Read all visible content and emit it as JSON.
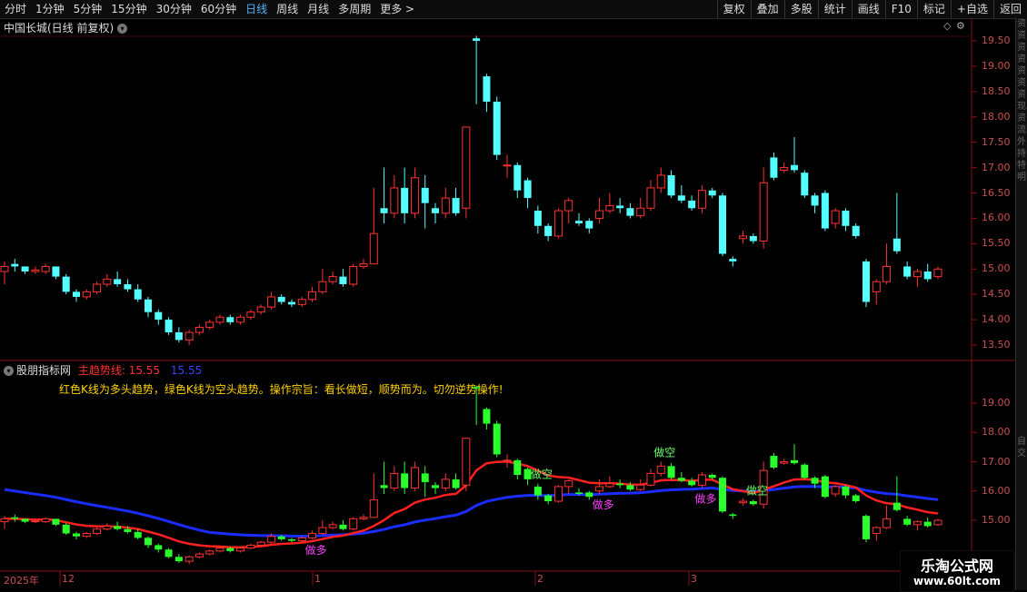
{
  "toolbar": {
    "periods": [
      "分时",
      "1分钟",
      "5分钟",
      "15分钟",
      "30分钟",
      "60分钟",
      "日线",
      "周线",
      "月线",
      "多周期",
      "更多 >"
    ],
    "active_period": "日线",
    "right_buttons": [
      "复权",
      "叠加",
      "多股",
      "统计",
      "画线",
      "F10",
      "标记",
      "+自选",
      "返回"
    ]
  },
  "stock_title": "中国长城(日线 前复权)",
  "indicator": {
    "name": "股朋指标网",
    "main_trend_label": "主趋势线: 15.55",
    "second_value": "15.55",
    "description": "红色K线为多头趋势，绿色K线为空头趋势。操作宗旨：看长做短，顺势而为。切勿逆势操作!"
  },
  "signals": {
    "short": "做空",
    "long": "做多"
  },
  "right_edge_text": [
    "资",
    "资",
    "资",
    "资",
    "资",
    "资",
    "资",
    "现",
    "资",
    "流",
    "外",
    "持",
    "特",
    "明"
  ],
  "right_edge_text2": [
    "自",
    "交"
  ],
  "timeline": {
    "year": "2025年",
    "months": [
      "12",
      "1",
      "2",
      "3"
    ]
  },
  "watermark": {
    "line1": "乐淘公式网",
    "line2": "www.60lt.com"
  },
  "colors": {
    "up": "#ff3232",
    "down_main": "#54ffff",
    "down_ind": "#2bff2b",
    "ma_red": "#ff2020",
    "ma_blue": "#1a2cff",
    "signal_green": "#6cff6c",
    "signal_magenta": "#ff40ff"
  },
  "chart_data": [
    {
      "type": "candlestick",
      "title": "中国长城(日线 前复权)",
      "y_ticks": [
        19.5,
        19.0,
        18.5,
        18.0,
        17.5,
        17.0,
        16.5,
        16.0,
        15.5,
        15.0,
        14.5,
        14.0,
        13.5
      ],
      "ylim": [
        13.2,
        19.8
      ],
      "candles": [
        [
          14.95,
          15.05,
          15.15,
          14.7
        ],
        [
          15.1,
          15.05,
          15.2,
          14.95
        ],
        [
          15.05,
          14.95,
          15.05,
          14.9
        ],
        [
          14.95,
          14.98,
          15.05,
          14.9
        ],
        [
          14.95,
          15.05,
          15.1,
          14.9
        ],
        [
          15.05,
          14.85,
          15.05,
          14.8
        ],
        [
          14.85,
          14.55,
          14.9,
          14.5
        ],
        [
          14.55,
          14.45,
          14.6,
          14.35
        ],
        [
          14.45,
          14.55,
          14.6,
          14.4
        ],
        [
          14.55,
          14.7,
          14.75,
          14.5
        ],
        [
          14.7,
          14.8,
          14.9,
          14.65
        ],
        [
          14.8,
          14.7,
          14.95,
          14.65
        ],
        [
          14.7,
          14.6,
          14.8,
          14.55
        ],
        [
          14.6,
          14.4,
          14.7,
          14.35
        ],
        [
          14.4,
          14.15,
          14.45,
          14.05
        ],
        [
          14.15,
          14.0,
          14.2,
          13.9
        ],
        [
          14.0,
          13.75,
          14.05,
          13.7
        ],
        [
          13.75,
          13.6,
          13.85,
          13.55
        ],
        [
          13.6,
          13.75,
          13.8,
          13.5
        ],
        [
          13.75,
          13.85,
          13.9,
          13.7
        ],
        [
          13.85,
          13.95,
          14.0,
          13.8
        ],
        [
          13.95,
          14.05,
          14.1,
          13.9
        ],
        [
          14.05,
          13.95,
          14.1,
          13.9
        ],
        [
          13.95,
          14.05,
          14.1,
          13.9
        ],
        [
          14.05,
          14.15,
          14.2,
          14.0
        ],
        [
          14.15,
          14.25,
          14.3,
          14.1
        ],
        [
          14.25,
          14.45,
          14.55,
          14.2
        ],
        [
          14.45,
          14.35,
          14.5,
          14.3
        ],
        [
          14.35,
          14.3,
          14.4,
          14.25
        ],
        [
          14.3,
          14.4,
          14.45,
          14.25
        ],
        [
          14.4,
          14.55,
          14.65,
          14.35
        ],
        [
          14.55,
          14.75,
          15.0,
          14.5
        ],
        [
          14.75,
          14.85,
          14.95,
          14.7
        ],
        [
          14.85,
          14.7,
          15.0,
          14.65
        ],
        [
          14.7,
          15.05,
          15.1,
          14.65
        ],
        [
          15.05,
          15.1,
          15.2,
          15.0
        ],
        [
          15.1,
          15.7,
          16.6,
          15.1
        ],
        [
          16.2,
          16.1,
          17.0,
          15.9
        ],
        [
          16.1,
          16.6,
          16.85,
          16.0
        ],
        [
          16.6,
          16.1,
          17.0,
          15.9
        ],
        [
          16.1,
          16.8,
          17.0,
          16.0
        ],
        [
          16.6,
          16.3,
          16.85,
          15.8
        ],
        [
          16.2,
          16.1,
          16.3,
          15.9
        ],
        [
          16.1,
          16.4,
          16.6,
          16.0
        ],
        [
          16.4,
          16.1,
          16.6,
          16.05
        ],
        [
          16.2,
          17.8,
          17.8,
          16.0
        ],
        [
          19.55,
          19.5,
          19.6,
          18.25
        ],
        [
          18.8,
          18.3,
          18.85,
          18.1
        ],
        [
          18.3,
          17.25,
          18.4,
          17.15
        ],
        [
          17.05,
          17.05,
          17.25,
          16.8
        ],
        [
          17.05,
          16.55,
          17.1,
          16.4
        ],
        [
          16.75,
          16.4,
          16.8,
          16.2
        ],
        [
          16.15,
          15.85,
          16.25,
          15.7
        ],
        [
          15.85,
          15.65,
          15.9,
          15.55
        ],
        [
          15.65,
          16.15,
          16.2,
          15.6
        ],
        [
          16.15,
          16.35,
          16.4,
          15.9
        ],
        [
          15.95,
          15.9,
          16.1,
          15.85
        ],
        [
          15.95,
          15.8,
          16.0,
          15.7
        ],
        [
          16.0,
          16.15,
          16.4,
          15.9
        ],
        [
          16.15,
          16.25,
          16.5,
          16.1
        ],
        [
          16.25,
          16.2,
          16.4,
          16.1
        ],
        [
          16.2,
          16.05,
          16.3,
          16.0
        ],
        [
          16.05,
          16.2,
          16.4,
          16.0
        ],
        [
          16.2,
          16.6,
          16.75,
          16.15
        ],
        [
          16.6,
          16.85,
          17.0,
          16.5
        ],
        [
          16.85,
          16.45,
          16.95,
          16.4
        ],
        [
          16.45,
          16.35,
          16.65,
          16.3
        ],
        [
          16.35,
          16.2,
          16.45,
          16.15
        ],
        [
          16.2,
          16.55,
          16.65,
          16.1
        ],
        [
          16.55,
          16.45,
          16.6,
          16.4
        ],
        [
          16.45,
          15.3,
          16.5,
          15.25
        ],
        [
          15.2,
          15.15,
          15.25,
          15.05
        ],
        [
          15.6,
          15.65,
          15.75,
          15.5
        ],
        [
          15.65,
          15.55,
          15.7,
          15.5
        ],
        [
          15.55,
          16.7,
          17.0,
          15.4
        ],
        [
          17.2,
          16.8,
          17.3,
          16.75
        ],
        [
          16.95,
          17.0,
          17.1,
          16.9
        ],
        [
          17.05,
          16.95,
          17.6,
          16.9
        ],
        [
          16.9,
          16.45,
          16.95,
          16.4
        ],
        [
          16.45,
          16.25,
          16.5,
          16.1
        ],
        [
          16.5,
          15.8,
          16.55,
          15.75
        ],
        [
          15.9,
          16.15,
          16.2,
          15.8
        ],
        [
          16.15,
          15.85,
          16.2,
          15.75
        ],
        [
          15.85,
          15.65,
          15.9,
          15.6
        ],
        [
          15.15,
          14.35,
          15.2,
          14.25
        ],
        [
          14.55,
          14.75,
          14.8,
          14.3
        ],
        [
          14.75,
          15.05,
          15.5,
          14.7
        ],
        [
          15.6,
          15.35,
          16.5,
          15.3
        ],
        [
          15.05,
          14.85,
          15.15,
          14.8
        ],
        [
          14.85,
          14.95,
          15.0,
          14.65
        ],
        [
          14.95,
          14.8,
          15.1,
          14.75
        ],
        [
          14.85,
          15.0,
          15.05,
          14.8
        ]
      ]
    },
    {
      "type": "candlestick-indicator",
      "title": "股朋指标网",
      "y_ticks": [
        19.0,
        18.0,
        17.0,
        16.0,
        15.0
      ],
      "ylim": [
        14.0,
        19.6
      ],
      "main_trend_value": 15.55,
      "series": [
        {
          "name": "主趋势线",
          "color": "red"
        },
        {
          "color": "blue"
        }
      ],
      "signals": [
        {
          "index": 30,
          "text": "做多"
        },
        {
          "index": 52,
          "text": "做空"
        },
        {
          "index": 58,
          "text": "做多"
        },
        {
          "index": 64,
          "text": "做空"
        },
        {
          "index": 68,
          "text": "做多"
        },
        {
          "index": 73,
          "text": "做空"
        }
      ]
    }
  ]
}
